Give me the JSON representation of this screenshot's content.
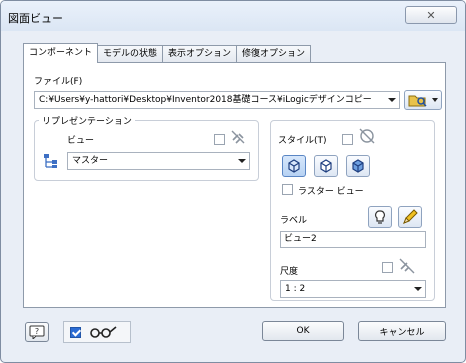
{
  "window": {
    "title": "図面ビュー",
    "close_label": "✕"
  },
  "tabs": [
    {
      "label": "コンポーネント"
    },
    {
      "label": "モデルの状態"
    },
    {
      "label": "表示オプション"
    },
    {
      "label": "修復オプション"
    }
  ],
  "file": {
    "label": "ファイル(F)",
    "path": "C:¥Users¥y-hattori¥Desktop¥Inventor2018基礎コース¥iLogicデザインコピー"
  },
  "representation": {
    "group_title": "リプレゼンテーション",
    "view_label": "ビュー",
    "view_value": "マスター"
  },
  "style": {
    "label": "スタイル(T)",
    "raster_view_label": "ラスター ビュー"
  },
  "label_section": {
    "label": "ラベル",
    "value": "ビュー2"
  },
  "scale": {
    "label": "尺度",
    "value": "1 : 2"
  },
  "buttons": {
    "ok": "OK",
    "cancel": "キャンセル",
    "help_icon": "?"
  }
}
